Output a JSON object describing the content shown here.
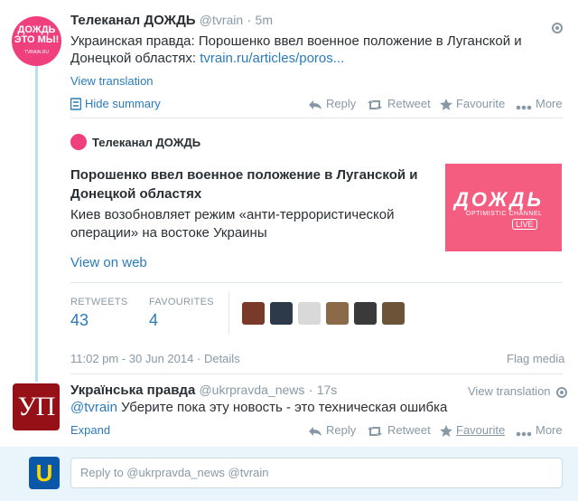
{
  "tweet1": {
    "name": "Телеканал ДОЖДЬ",
    "handle": "@tvrain",
    "sep": "·",
    "time": "5m",
    "text": "Украинская правда: Порошенко ввел военное положение в Луганской и Донецкой областях:",
    "link": "tvrain.ru/articles/poros...",
    "view_translation": "View translation",
    "hide_summary": "Hide summary",
    "actions": {
      "reply": "Reply",
      "retweet": "Retweet",
      "favourite": "Favourite",
      "more": "More"
    },
    "avatar_text": {
      "l1": "ДОЖДЬ",
      "l2": "ЭТО МЫ!",
      "l3": "TVRAIN.RU"
    }
  },
  "card": {
    "source_name": "Телеканал ДОЖДЬ",
    "title": "Порошенко ввел военное положение в Луганской и Донецкой областях",
    "description": "Киев возобновляет режим «анти-террористической операции» на востоке Украины",
    "view_on_web": "View on web",
    "logo": {
      "big": "ДОЖДЬ",
      "sub": "OPTIMISTIC CHANNEL",
      "live": "LIVE"
    }
  },
  "stats": {
    "retweets_label": "RETWEETS",
    "retweets": "43",
    "favourites_label": "FAVOURITES",
    "favourites": "4",
    "thumb_colors": [
      "#7a3a2a",
      "#2c3a4a",
      "#d9d9d9",
      "#8a6a48",
      "#3a3a3a",
      "#6b5438"
    ]
  },
  "meta": {
    "datetime": "11:02 pm - 30 Jun 2014",
    "sep": "·",
    "details": "Details",
    "flag": "Flag media"
  },
  "tweet2": {
    "name": "Українська правда",
    "handle": "@ukrpravda_news",
    "sep": "·",
    "time": "17s",
    "view_translation": "View translation",
    "mention": "@tvrain",
    "text": "Уберите пока эту новость - это техническая ошибка",
    "expand": "Expand",
    "actions": {
      "reply": "Reply",
      "retweet": "Retweet",
      "favourite": "Favourite",
      "more": "More"
    },
    "avatar_text": "УП"
  },
  "reply": {
    "placeholder": "Reply to @ukrpravda_news @tvrain",
    "avatar_letter": "U"
  },
  "colors": {
    "accent": "#2b7bb9",
    "muted": "#8899a6",
    "brand_pink": "#ef3f7d",
    "up_red": "#951117"
  }
}
